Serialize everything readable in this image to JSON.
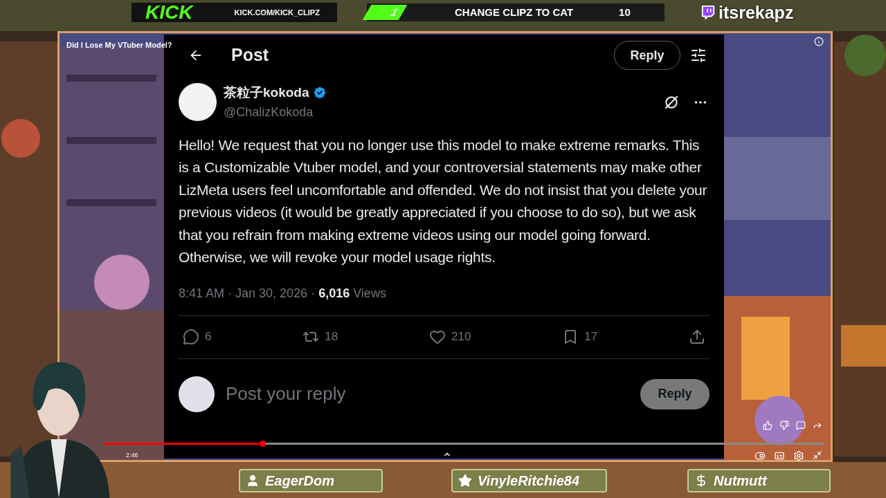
{
  "top_bar": {
    "brand": "KICK",
    "url": "KICK.COM/KICK_CLIPZ",
    "counter": "1",
    "goal": "CHANGE CLIPZ TO CAT",
    "goal_count": "10",
    "channel": "itsrekapz"
  },
  "video": {
    "title": "Did I Lose My VTuber Model?",
    "time": "2:46",
    "progress": {
      "level": 0.22
    }
  },
  "post": {
    "header_title": "Post",
    "header_button": "Reply",
    "author": {
      "name": "茶粒子kokoda",
      "handle": "@ChalizKokoda",
      "verified": true
    },
    "text": "Hello! We request that you no longer use this model to make extreme remarks. This is a Customizable Vtuber model, and your controversial statements may make other LizMeta users feel uncomfortable and offended. We do not insist that you delete your previous videos (it would be greatly appreciated if you choose to do so), but we ask that you refrain from making extreme videos using our model going forward. Otherwise, we will revoke your model usage rights.",
    "timestamp": "8:41 AM · Jan 30, 2026 · ",
    "views_count": "6,016",
    "views_label": "Views",
    "actions": [
      {
        "kind": "reply",
        "count": "6"
      },
      {
        "kind": "repost",
        "count": "18"
      },
      {
        "kind": "like",
        "count": "210"
      },
      {
        "kind": "bookmark",
        "count": "17"
      },
      {
        "kind": "share"
      }
    ],
    "composer": {
      "placeholder": "Post your reply",
      "button": "Reply"
    }
  },
  "name_plates": [
    {
      "kind": "follower",
      "name": "EagerDom"
    },
    {
      "kind": "subscriber",
      "name": "VinyleRitchie84"
    },
    {
      "kind": "donation",
      "name": "Nutmutt"
    }
  ]
}
